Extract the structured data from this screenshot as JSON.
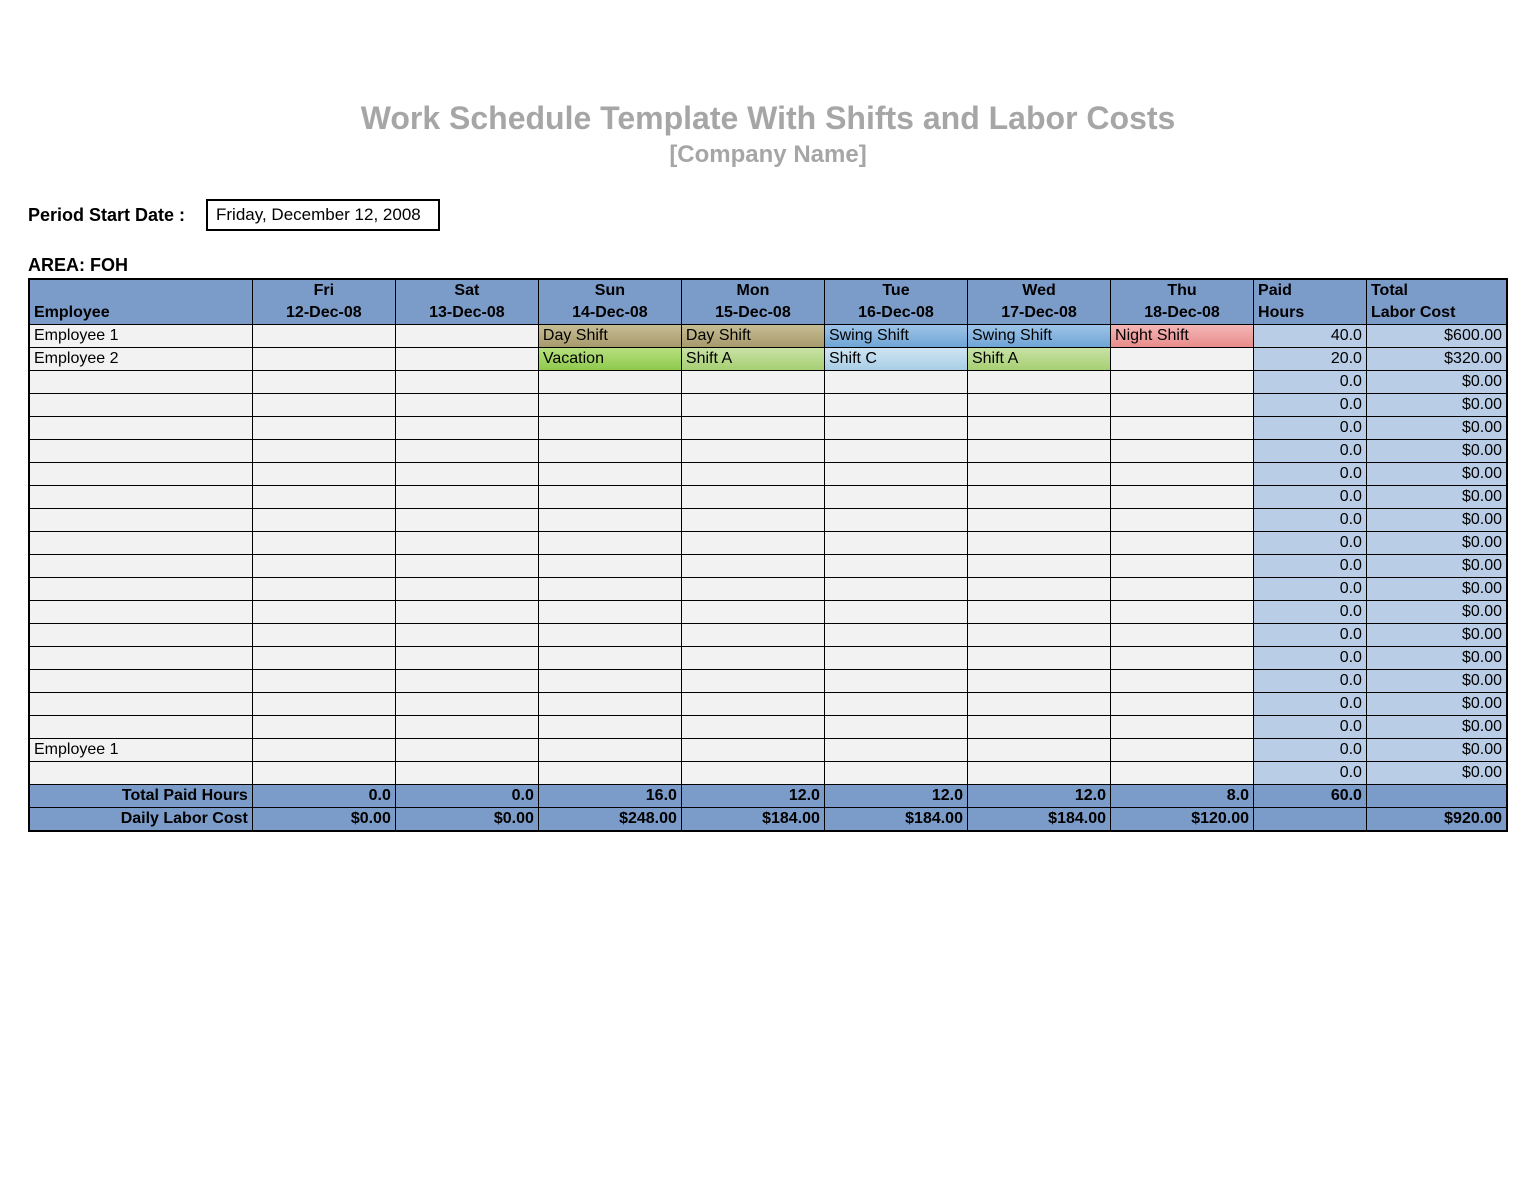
{
  "title": "Work Schedule Template With Shifts and Labor Costs",
  "subtitle": "[Company Name]",
  "period_label": "Period Start Date :",
  "period_value": "Friday, December 12, 2008",
  "area_label": "AREA: FOH",
  "columns": {
    "employee": "Employee",
    "days": [
      {
        "dow": "Fri",
        "date": "12-Dec-08"
      },
      {
        "dow": "Sat",
        "date": "13-Dec-08"
      },
      {
        "dow": "Sun",
        "date": "14-Dec-08"
      },
      {
        "dow": "Mon",
        "date": "15-Dec-08"
      },
      {
        "dow": "Tue",
        "date": "16-Dec-08"
      },
      {
        "dow": "Wed",
        "date": "17-Dec-08"
      },
      {
        "dow": "Thu",
        "date": "18-Dec-08"
      }
    ],
    "paid_hours_top": "Paid",
    "paid_hours_bot": "Hours",
    "total_cost_top": "Total",
    "total_cost_bot": "Labor Cost"
  },
  "shift_labels": {
    "day": "Day Shift",
    "swing": "Swing Shift",
    "night": "Night Shift",
    "shifta": "Shift A",
    "shiftc": "Shift C",
    "vac": "Vacation"
  },
  "rows": [
    {
      "employee": "Employee 1",
      "shifts": [
        "",
        "",
        "day",
        "day",
        "swing",
        "swing",
        "night"
      ],
      "hours": "40.0",
      "cost": "$600.00"
    },
    {
      "employee": "Employee 2",
      "shifts": [
        "",
        "",
        "vac",
        "shifta",
        "shiftc",
        "shifta",
        ""
      ],
      "hours": "20.0",
      "cost": "$320.00"
    },
    {
      "employee": "",
      "shifts": [
        "",
        "",
        "",
        "",
        "",
        "",
        ""
      ],
      "hours": "0.0",
      "cost": "$0.00"
    },
    {
      "employee": "",
      "shifts": [
        "",
        "",
        "",
        "",
        "",
        "",
        ""
      ],
      "hours": "0.0",
      "cost": "$0.00"
    },
    {
      "employee": "",
      "shifts": [
        "",
        "",
        "",
        "",
        "",
        "",
        ""
      ],
      "hours": "0.0",
      "cost": "$0.00"
    },
    {
      "employee": "",
      "shifts": [
        "",
        "",
        "",
        "",
        "",
        "",
        ""
      ],
      "hours": "0.0",
      "cost": "$0.00"
    },
    {
      "employee": "",
      "shifts": [
        "",
        "",
        "",
        "",
        "",
        "",
        ""
      ],
      "hours": "0.0",
      "cost": "$0.00"
    },
    {
      "employee": "",
      "shifts": [
        "",
        "",
        "",
        "",
        "",
        "",
        ""
      ],
      "hours": "0.0",
      "cost": "$0.00"
    },
    {
      "employee": "",
      "shifts": [
        "",
        "",
        "",
        "",
        "",
        "",
        ""
      ],
      "hours": "0.0",
      "cost": "$0.00"
    },
    {
      "employee": "",
      "shifts": [
        "",
        "",
        "",
        "",
        "",
        "",
        ""
      ],
      "hours": "0.0",
      "cost": "$0.00"
    },
    {
      "employee": "",
      "shifts": [
        "",
        "",
        "",
        "",
        "",
        "",
        ""
      ],
      "hours": "0.0",
      "cost": "$0.00"
    },
    {
      "employee": "",
      "shifts": [
        "",
        "",
        "",
        "",
        "",
        "",
        ""
      ],
      "hours": "0.0",
      "cost": "$0.00"
    },
    {
      "employee": "",
      "shifts": [
        "",
        "",
        "",
        "",
        "",
        "",
        ""
      ],
      "hours": "0.0",
      "cost": "$0.00"
    },
    {
      "employee": "",
      "shifts": [
        "",
        "",
        "",
        "",
        "",
        "",
        ""
      ],
      "hours": "0.0",
      "cost": "$0.00"
    },
    {
      "employee": "",
      "shifts": [
        "",
        "",
        "",
        "",
        "",
        "",
        ""
      ],
      "hours": "0.0",
      "cost": "$0.00"
    },
    {
      "employee": "",
      "shifts": [
        "",
        "",
        "",
        "",
        "",
        "",
        ""
      ],
      "hours": "0.0",
      "cost": "$0.00"
    },
    {
      "employee": "",
      "shifts": [
        "",
        "",
        "",
        "",
        "",
        "",
        ""
      ],
      "hours": "0.0",
      "cost": "$0.00"
    },
    {
      "employee": "",
      "shifts": [
        "",
        "",
        "",
        "",
        "",
        "",
        ""
      ],
      "hours": "0.0",
      "cost": "$0.00"
    },
    {
      "employee": "Employee 1",
      "shifts": [
        "",
        "",
        "",
        "",
        "",
        "",
        ""
      ],
      "hours": "0.0",
      "cost": "$0.00"
    },
    {
      "employee": "",
      "shifts": [
        "",
        "",
        "",
        "",
        "",
        "",
        ""
      ],
      "hours": "0.0",
      "cost": "$0.00"
    }
  ],
  "footer": {
    "total_paid_label": "Total Paid Hours",
    "total_paid_values": [
      "0.0",
      "0.0",
      "16.0",
      "12.0",
      "12.0",
      "12.0",
      "8.0"
    ],
    "total_paid_grand": "60.0",
    "daily_cost_label": "Daily Labor Cost",
    "daily_cost_values": [
      "$0.00",
      "$0.00",
      "$248.00",
      "$184.00",
      "$184.00",
      "$184.00",
      "$120.00"
    ],
    "daily_cost_grand": "$920.00"
  }
}
